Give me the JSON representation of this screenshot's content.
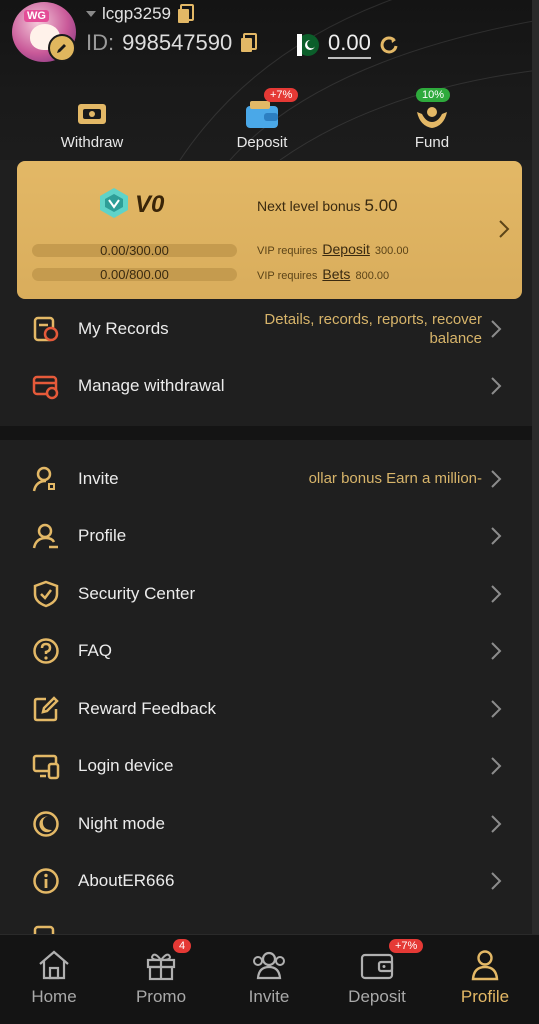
{
  "header": {
    "username": "lcgp3259",
    "id_label": "ID:",
    "id_value": "998547590",
    "balance": "0.00",
    "avatar_text": "WG"
  },
  "quick_actions": [
    {
      "label": "Withdraw",
      "badge": ""
    },
    {
      "label": "Deposit",
      "badge": "+7%"
    },
    {
      "label": "Fund",
      "badge": "10%"
    }
  ],
  "vip": {
    "level": "V0",
    "next_level_label": "Next level bonus",
    "next_level_value": "5.00",
    "progress_deposit": "0.00/300.00",
    "progress_bets": "0.00/800.00",
    "req_prefix": "VIP requires",
    "req_deposit_link": "Deposit",
    "req_deposit_value": "300.00",
    "req_bets_link": "Bets",
    "req_bets_value": "800.00"
  },
  "rows_top": [
    {
      "label": "My Records",
      "right_line1": "Details, records, reports, recover",
      "right_line2": "balance"
    },
    {
      "label": "Manage withdrawal"
    }
  ],
  "rows_main": [
    {
      "label": "Invite",
      "right": "ollar bonus  Earn a million-"
    },
    {
      "label": "Profile"
    },
    {
      "label": "Security Center"
    },
    {
      "label": "FAQ"
    },
    {
      "label": "Reward Feedback"
    },
    {
      "label": "Login device"
    },
    {
      "label": "Night mode"
    },
    {
      "label": "AboutER666"
    }
  ],
  "nav": [
    {
      "label": "Home",
      "badge": ""
    },
    {
      "label": "Promo",
      "badge": "4"
    },
    {
      "label": "Invite",
      "badge": ""
    },
    {
      "label": "Deposit",
      "badge": "+7%"
    },
    {
      "label": "Profile",
      "badge": ""
    }
  ],
  "colors": {
    "accent": "#e3b866",
    "badge_red": "#e53935",
    "badge_green": "#2eaa3c",
    "bg": "#1f1f1f"
  }
}
